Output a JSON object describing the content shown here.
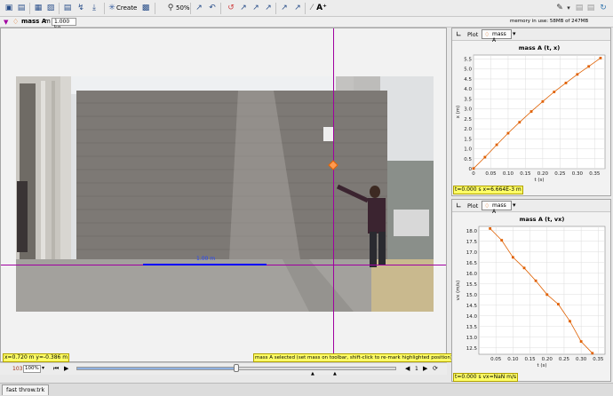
{
  "toolbar": {
    "create_label": "Create",
    "zoom_label": "50%",
    "memory_text": "memory in use: 58MB of 247MB"
  },
  "track": {
    "name": "mass A",
    "mass_label": "m",
    "mass_value": "1.000 kg"
  },
  "video": {
    "readout": "x=0.720 m  y=-0.386 m",
    "status": "mass A selected (set mass on toolbar, shift-click to re-mark highlighted position)",
    "calib_label": "1.00 m"
  },
  "player": {
    "frame": "103",
    "zoom": "100%",
    "step": "1",
    "progress": 0.5
  },
  "plot1": {
    "tab_label": "Plot",
    "track_label": "mass A",
    "readout": "t=0.000 s  x=6.664E-3 m"
  },
  "plot2": {
    "tab_label": "Plot",
    "track_label": "mass A",
    "readout": "t=0.000 s  vx=NaN m/s"
  },
  "file_tab": "fast throw.trk",
  "colors": {
    "track": "#e06000",
    "axis": "#a000a0",
    "readout": "#ffff66",
    "calib": "#0000ff"
  },
  "chart_data": [
    {
      "type": "line",
      "title": "mass A (t, x)",
      "xlabel": "t (s)",
      "ylabel": "x (m)",
      "xlim": [
        0,
        0.38
      ],
      "ylim": [
        0,
        5.7
      ],
      "xticks": [
        "0",
        "0.05",
        "0.10",
        "0.15",
        "0.20",
        "0.25",
        "0.30",
        "0.35"
      ],
      "yticks": [
        "0",
        "0.5",
        "1.0",
        "1.5",
        "2.0",
        "2.5",
        "3.0",
        "3.5",
        "4.0",
        "4.5",
        "5.0",
        "5.5"
      ],
      "x": [
        0.0,
        0.033,
        0.067,
        0.1,
        0.133,
        0.167,
        0.2,
        0.233,
        0.267,
        0.3,
        0.333,
        0.367
      ],
      "y": [
        0.01,
        0.58,
        1.2,
        1.78,
        2.33,
        2.87,
        3.37,
        3.85,
        4.3,
        4.73,
        5.13,
        5.55
      ]
    },
    {
      "type": "line",
      "title": "mass A (t, vx)",
      "xlabel": "t (s)",
      "ylabel": "vx (m/s)",
      "xlim": [
        0,
        0.37
      ],
      "ylim": [
        12.2,
        18.2
      ],
      "xticks": [
        "0.05",
        "0.10",
        "0.15",
        "0.20",
        "0.25",
        "0.30",
        "0.35"
      ],
      "yticks": [
        "12.5",
        "13.0",
        "13.5",
        "14.0",
        "14.5",
        "15.0",
        "15.5",
        "16.0",
        "16.5",
        "17.0",
        "17.5",
        "18.0"
      ],
      "x": [
        0.033,
        0.067,
        0.1,
        0.133,
        0.167,
        0.2,
        0.233,
        0.267,
        0.3,
        0.333
      ],
      "y": [
        18.1,
        17.55,
        16.75,
        16.25,
        15.65,
        15.0,
        14.55,
        13.75,
        12.8,
        12.25
      ]
    }
  ]
}
